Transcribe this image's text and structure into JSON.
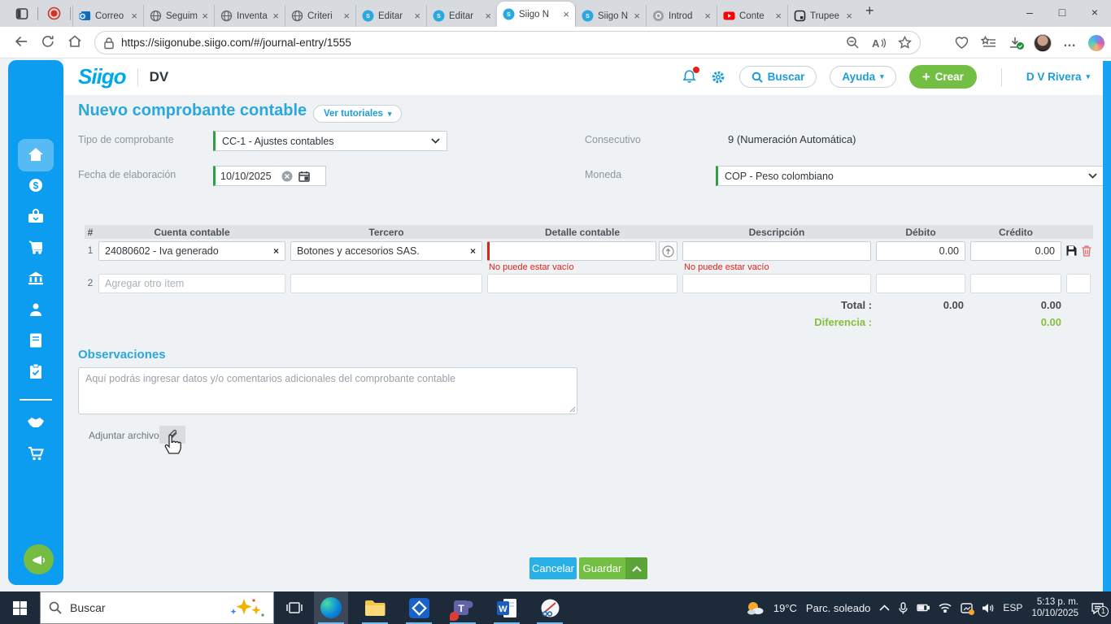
{
  "browser": {
    "tabs": [
      {
        "label": "Correo"
      },
      {
        "label": "Seguim"
      },
      {
        "label": "Inventa"
      },
      {
        "label": "Criteri"
      },
      {
        "label": "Editar"
      },
      {
        "label": "Editar"
      },
      {
        "label": "Siigo N"
      },
      {
        "label": "Siigo N"
      },
      {
        "label": "Introd"
      },
      {
        "label": "Conte"
      },
      {
        "label": "Trupee"
      }
    ],
    "new_tab_label": "+",
    "url": "https://siigonube.siigo.com/#/journal-entry/1555"
  },
  "siigo_header": {
    "logo_text": "Siigo",
    "company": "DV",
    "search_label": "Buscar",
    "help_label": "Ayuda",
    "create_plus": "+",
    "create_label": "Crear",
    "user": "D V Rivera"
  },
  "page": {
    "title": "Nuevo comprobante contable",
    "tutorials_label": "Ver tutoriales",
    "fields": {
      "tipo_label": "Tipo de comprobante",
      "tipo_value": "CC-1 - Ajustes contables",
      "consecutivo_label": "Consecutivo",
      "consecutivo_value": "9 (Numeración Automática)",
      "fecha_label": "Fecha de elaboración",
      "fecha_value": "10/10/2025",
      "moneda_label": "Moneda",
      "moneda_value": "COP - Peso colombiano"
    },
    "table": {
      "headers": [
        "#",
        "Cuenta contable",
        "Tercero",
        "Detalle contable",
        "Descripción",
        "Débito",
        "Crédito"
      ],
      "row1": {
        "num": "1",
        "cuenta": "24080602 - Iva generado",
        "tercero": "Botones y accesorios SAS.",
        "detalle_error": "No puede estar vacío",
        "descripcion_error": "No puede estar vacío",
        "debito": "0.00",
        "credito": "0.00"
      },
      "row2": {
        "num": "2",
        "cuenta_placeholder": "Agregar otro ítem"
      },
      "totals": {
        "total_label": "Total :",
        "total_debito": "0.00",
        "total_credito": "0.00",
        "diferencia_label": "Diferencia :",
        "diferencia_value": "0.00"
      }
    },
    "observaciones": {
      "title": "Observaciones",
      "placeholder": "Aquí podrás ingresar datos y/o comentarios adicionales del comprobante contable"
    },
    "attach_label": "Adjuntar archivo",
    "buttons": {
      "cancel": "Cancelar",
      "save": "Guardar"
    }
  },
  "taskbar": {
    "search_placeholder": "Buscar",
    "weather_temp": "19°C",
    "weather_desc": "Parc. soleado",
    "lang": "ESP",
    "time": "5:13 p. m.",
    "date": "10/10/2025",
    "notification_count": "1"
  },
  "colors": {
    "sidebar_blue": "#0d9df0",
    "accent_green": "#72bf44",
    "cancel_blue": "#29b0e8",
    "error_red": "#e2231a",
    "link_blue": "#1b9dd9",
    "diff_green": "#86bf3f"
  }
}
